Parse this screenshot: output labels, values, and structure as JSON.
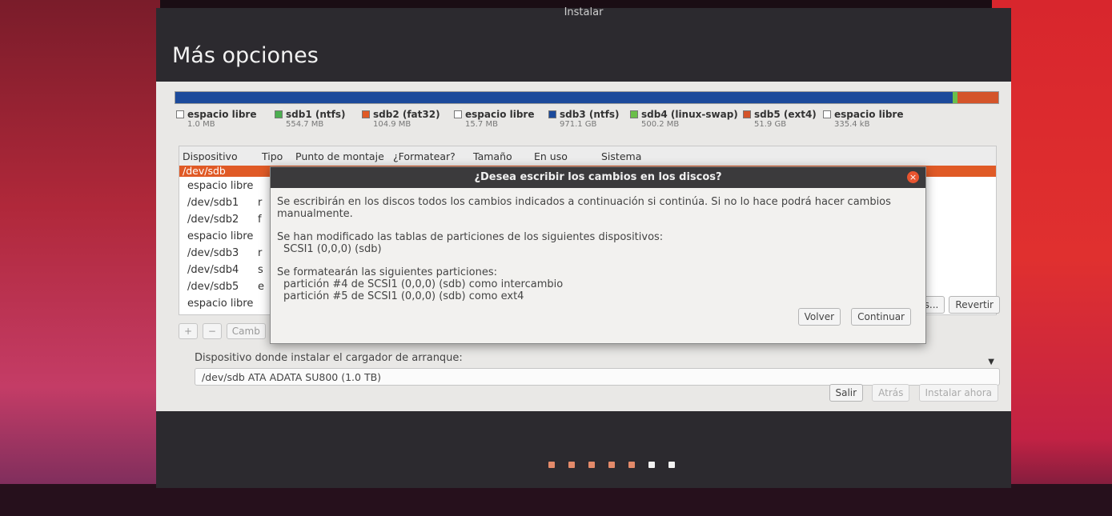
{
  "window": {
    "title": "Instalar"
  },
  "page": {
    "title": "Más opciones"
  },
  "colors": {
    "free": "#ffffff",
    "ntfs": "#1c4a9b",
    "ntfs_sdb1": "#4caf50",
    "fat32": "#e05a26",
    "swap": "#6bbf4a",
    "ext4": "#d4542a",
    "accent": "#e05a26"
  },
  "legend": [
    {
      "name": "espacio libre",
      "size": "1.0 MB",
      "color": "#ffffff"
    },
    {
      "name": "sdb1 (ntfs)",
      "size": "554.7 MB",
      "color": "#4caf50"
    },
    {
      "name": "sdb2 (fat32)",
      "size": "104.9 MB",
      "color": "#e05a26"
    },
    {
      "name": "espacio libre",
      "size": "15.7 MB",
      "color": "#ffffff"
    },
    {
      "name": "sdb3 (ntfs)",
      "size": "971.1 GB",
      "color": "#1c4a9b"
    },
    {
      "name": "sdb4 (linux-swap)",
      "size": "500.2 MB",
      "color": "#6bbf4a"
    },
    {
      "name": "sdb5 (ext4)",
      "size": "51.9 GB",
      "color": "#d4542a"
    },
    {
      "name": "espacio libre",
      "size": "335.4 kB",
      "color": "#ffffff"
    }
  ],
  "table": {
    "headers": [
      "Dispositivo",
      "Tipo",
      "Punto de montaje",
      "¿Formatear?",
      "Tamaño",
      "En uso",
      "Sistema"
    ],
    "selected": "/dev/sdb",
    "rows": [
      {
        "device": "espacio libre",
        "extra": ""
      },
      {
        "device": "/dev/sdb1",
        "extra": "r"
      },
      {
        "device": "/dev/sdb2",
        "extra": "f"
      },
      {
        "device": "espacio libre",
        "extra": ""
      },
      {
        "device": "/dev/sdb3",
        "extra": "r"
      },
      {
        "device": "/dev/sdb4",
        "extra": "s"
      },
      {
        "device": "/dev/sdb5",
        "extra": "e"
      },
      {
        "device": "espacio libre",
        "extra": ""
      }
    ]
  },
  "toolbar": {
    "add": "+",
    "remove": "−",
    "change": "Camb"
  },
  "partition_buttons": {
    "new_table": "nes...",
    "revert": "Revertir"
  },
  "bootloader": {
    "label": "Dispositivo donde instalar el cargador de arranque:",
    "value": "/dev/sdb   ATA ADATA SU800 (1.0 TB)"
  },
  "bottom_buttons": {
    "quit": "Salir",
    "back": "Atrás",
    "install": "Instalar ahora"
  },
  "dialog": {
    "title": "¿Desea escribir los cambios en los discos?",
    "close_glyph": "×",
    "line1": "Se escribirán en los discos todos los cambios indicados a continuación si continúa. Si no lo hace podrá hacer cambios manualmente.",
    "line2": "Se han modificado las tablas de particiones de los siguientes dispositivos:",
    "line3": "SCSI1 (0,0,0) (sdb)",
    "line4": "Se formatearán las siguientes particiones:",
    "line5": "partición #4 de SCSI1 (0,0,0) (sdb) como intercambio",
    "line6": "partición #5 de SCSI1 (0,0,0) (sdb) como ext4",
    "back_button": "Volver",
    "continue_button": "Continuar"
  },
  "progress_dots": {
    "total": 7,
    "done": 5
  }
}
